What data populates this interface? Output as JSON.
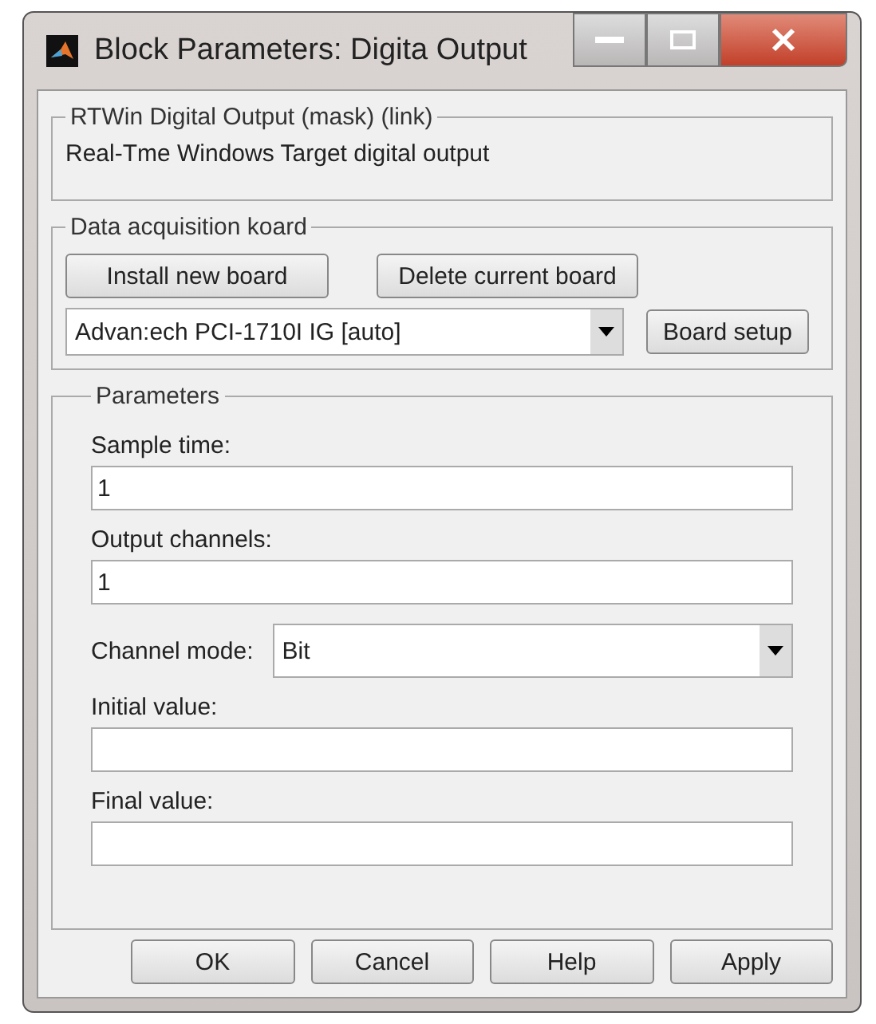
{
  "window": {
    "title": "Block Parameters: Digita Output"
  },
  "description_group": {
    "title": "RTWin Digital Output (mask) (link)",
    "text": "Real-Tme Windows Target digital output"
  },
  "board_group": {
    "title": "Data acquisition koard",
    "buttons": [
      "Install new board",
      "Delete current board"
    ],
    "board_select": {
      "value": "Advan:ech PCI-1710I IG [auto]"
    },
    "setup_button": "Board setup"
  },
  "parameters": {
    "title": "Parameters",
    "items": [
      {
        "kind": "text",
        "label": "Sample time:",
        "value": "1"
      },
      {
        "kind": "text",
        "label": "Output channels:",
        "value": "1"
      },
      {
        "kind": "select",
        "label": "Channel mode:",
        "value": "Bit"
      },
      {
        "kind": "text",
        "label": "Initial value:",
        "value": ""
      },
      {
        "kind": "text",
        "label": "Final value:",
        "value": ""
      }
    ]
  },
  "buttons": [
    "OK",
    "Cancel",
    "Help",
    "Apply"
  ]
}
